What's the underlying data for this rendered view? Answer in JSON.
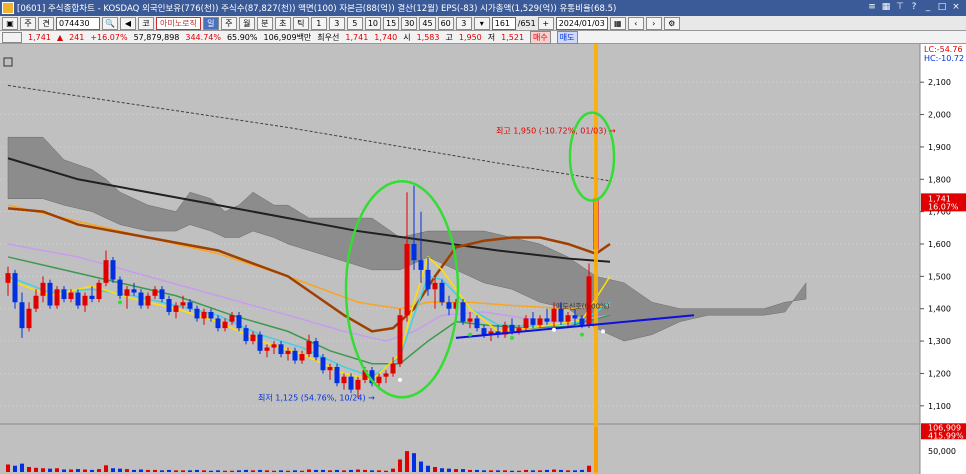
{
  "title": "[0601] 주식종합차트 - KOSDAQ 외국인보유(776(천)) 주식수(87,827(천)) 액면(100) 자본금(88(억)) 결산(12월) EPS(-83) 시가총액(1,529(억)) 유통비율(68.5)",
  "toolbar": {
    "code": "074430",
    "stock_name": "아미노로직",
    "periods": [
      "주",
      "월",
      "분",
      "초",
      "틱"
    ],
    "minute_options": [
      "1",
      "3",
      "5",
      "10",
      "15",
      "30",
      "45",
      "60"
    ],
    "count_value": "161",
    "count_total": "/651",
    "date": "2024/01/03",
    "left_labels": [
      "주",
      "견"
    ],
    "kind_label": "코"
  },
  "quote": {
    "price": "1,741",
    "change": "241",
    "change_pct": "+16.07%",
    "volume": "57,879,898",
    "vol_ratio": "344.74%",
    "turnover": "65.90%",
    "amount": "106,909백만",
    "best_label": "최우선",
    "ask": "1,741",
    "bid": "1,740",
    "open_label": "시",
    "open": "1,583",
    "high_label": "고",
    "high": "1,950",
    "low_label": "저",
    "low": "1,521",
    "buy_label": "매수",
    "sell_label": "매도"
  },
  "colors": {
    "up": "#e00000",
    "down": "#0030e0",
    "cloud": "#8c8c8c",
    "ma_black": "#202020",
    "ma_brown": "#a04000",
    "ma_orange": "#f5a623",
    "ma_violet": "#c79cf0",
    "ma_green": "#3a9a50",
    "ma_cyan": "#40d0e0",
    "ma_yellow": "#ffe000",
    "highlight": "#33dd33",
    "trend": "#1010dd",
    "cursor": "#ffb000"
  },
  "chart_data": {
    "type": "candlestick",
    "y_axis_ticks": [
      "2,100",
      "2,000",
      "1,900",
      "1,800",
      "1,700",
      "1,600",
      "1,500",
      "1,400",
      "1,300",
      "1,200",
      "1,100"
    ],
    "ylim": [
      1050,
      2150
    ],
    "current_price_label": "1,741",
    "current_change_label": "16.07%",
    "lc_label": "LC:-54.76",
    "hc_label": "HC:-10.72",
    "high_annotation": "최고 1,950 (-10.72%, 01/03)",
    "low_annotation": "최저 1,125 (54.76%, 10/24)",
    "mid_annotation": "매도신호(0.00%)",
    "volume_axis_ticks": [
      "50,000"
    ],
    "volume_current_label": "106,909",
    "volume_pct_label": "415.99%",
    "volume_ylim": [
      0,
      110000
    ],
    "candles": [
      {
        "o": 1480,
        "h": 1530,
        "l": 1440,
        "c": 1510,
        "v": 18000
      },
      {
        "o": 1510,
        "h": 1520,
        "l": 1400,
        "c": 1420,
        "v": 15000
      },
      {
        "o": 1420,
        "h": 1450,
        "l": 1310,
        "c": 1340,
        "v": 20000
      },
      {
        "o": 1340,
        "h": 1420,
        "l": 1330,
        "c": 1400,
        "v": 12000
      },
      {
        "o": 1400,
        "h": 1460,
        "l": 1390,
        "c": 1440,
        "v": 10000
      },
      {
        "o": 1440,
        "h": 1500,
        "l": 1420,
        "c": 1480,
        "v": 9000
      },
      {
        "o": 1480,
        "h": 1490,
        "l": 1400,
        "c": 1410,
        "v": 8000
      },
      {
        "o": 1410,
        "h": 1470,
        "l": 1400,
        "c": 1460,
        "v": 9000
      },
      {
        "o": 1460,
        "h": 1470,
        "l": 1420,
        "c": 1430,
        "v": 6000
      },
      {
        "o": 1430,
        "h": 1460,
        "l": 1420,
        "c": 1450,
        "v": 6000
      },
      {
        "o": 1450,
        "h": 1460,
        "l": 1400,
        "c": 1410,
        "v": 7000
      },
      {
        "o": 1410,
        "h": 1450,
        "l": 1390,
        "c": 1440,
        "v": 6000
      },
      {
        "o": 1440,
        "h": 1470,
        "l": 1420,
        "c": 1430,
        "v": 5000
      },
      {
        "o": 1430,
        "h": 1490,
        "l": 1420,
        "c": 1480,
        "v": 7000
      },
      {
        "o": 1480,
        "h": 1580,
        "l": 1470,
        "c": 1550,
        "v": 16000
      },
      {
        "o": 1550,
        "h": 1560,
        "l": 1480,
        "c": 1490,
        "v": 9000
      },
      {
        "o": 1490,
        "h": 1500,
        "l": 1430,
        "c": 1440,
        "v": 8000
      },
      {
        "o": 1440,
        "h": 1470,
        "l": 1400,
        "c": 1460,
        "v": 7000
      },
      {
        "o": 1460,
        "h": 1480,
        "l": 1440,
        "c": 1450,
        "v": 5000
      },
      {
        "o": 1450,
        "h": 1460,
        "l": 1400,
        "c": 1410,
        "v": 6000
      },
      {
        "o": 1410,
        "h": 1450,
        "l": 1400,
        "c": 1440,
        "v": 5000
      },
      {
        "o": 1440,
        "h": 1470,
        "l": 1430,
        "c": 1460,
        "v": 5000
      },
      {
        "o": 1460,
        "h": 1470,
        "l": 1420,
        "c": 1430,
        "v": 4000
      },
      {
        "o": 1430,
        "h": 1440,
        "l": 1380,
        "c": 1390,
        "v": 5000
      },
      {
        "o": 1390,
        "h": 1420,
        "l": 1370,
        "c": 1410,
        "v": 4000
      },
      {
        "o": 1410,
        "h": 1440,
        "l": 1400,
        "c": 1420,
        "v": 4000
      },
      {
        "o": 1420,
        "h": 1430,
        "l": 1390,
        "c": 1400,
        "v": 4000
      },
      {
        "o": 1400,
        "h": 1410,
        "l": 1360,
        "c": 1370,
        "v": 5000
      },
      {
        "o": 1370,
        "h": 1400,
        "l": 1350,
        "c": 1390,
        "v": 4000
      },
      {
        "o": 1390,
        "h": 1400,
        "l": 1360,
        "c": 1370,
        "v": 3000
      },
      {
        "o": 1370,
        "h": 1380,
        "l": 1330,
        "c": 1340,
        "v": 4000
      },
      {
        "o": 1340,
        "h": 1370,
        "l": 1330,
        "c": 1360,
        "v": 3000
      },
      {
        "o": 1360,
        "h": 1390,
        "l": 1350,
        "c": 1380,
        "v": 3000
      },
      {
        "o": 1380,
        "h": 1390,
        "l": 1330,
        "c": 1340,
        "v": 4000
      },
      {
        "o": 1340,
        "h": 1350,
        "l": 1290,
        "c": 1300,
        "v": 5000
      },
      {
        "o": 1300,
        "h": 1330,
        "l": 1290,
        "c": 1320,
        "v": 4000
      },
      {
        "o": 1320,
        "h": 1330,
        "l": 1260,
        "c": 1270,
        "v": 5000
      },
      {
        "o": 1270,
        "h": 1290,
        "l": 1250,
        "c": 1280,
        "v": 4000
      },
      {
        "o": 1280,
        "h": 1300,
        "l": 1260,
        "c": 1290,
        "v": 3000
      },
      {
        "o": 1290,
        "h": 1300,
        "l": 1250,
        "c": 1260,
        "v": 4000
      },
      {
        "o": 1260,
        "h": 1280,
        "l": 1240,
        "c": 1270,
        "v": 3000
      },
      {
        "o": 1270,
        "h": 1280,
        "l": 1230,
        "c": 1240,
        "v": 4000
      },
      {
        "o": 1240,
        "h": 1270,
        "l": 1230,
        "c": 1260,
        "v": 3000
      },
      {
        "o": 1260,
        "h": 1320,
        "l": 1250,
        "c": 1300,
        "v": 6000
      },
      {
        "o": 1300,
        "h": 1310,
        "l": 1240,
        "c": 1250,
        "v": 5000
      },
      {
        "o": 1250,
        "h": 1260,
        "l": 1200,
        "c": 1210,
        "v": 5000
      },
      {
        "o": 1210,
        "h": 1230,
        "l": 1180,
        "c": 1220,
        "v": 4000
      },
      {
        "o": 1220,
        "h": 1230,
        "l": 1160,
        "c": 1170,
        "v": 5000
      },
      {
        "o": 1170,
        "h": 1200,
        "l": 1150,
        "c": 1190,
        "v": 4000
      },
      {
        "o": 1190,
        "h": 1200,
        "l": 1140,
        "c": 1150,
        "v": 5000
      },
      {
        "o": 1150,
        "h": 1190,
        "l": 1125,
        "c": 1180,
        "v": 6000
      },
      {
        "o": 1180,
        "h": 1220,
        "l": 1170,
        "c": 1210,
        "v": 5000
      },
      {
        "o": 1210,
        "h": 1220,
        "l": 1160,
        "c": 1170,
        "v": 4000
      },
      {
        "o": 1170,
        "h": 1200,
        "l": 1150,
        "c": 1190,
        "v": 4000
      },
      {
        "o": 1190,
        "h": 1210,
        "l": 1170,
        "c": 1200,
        "v": 3000
      },
      {
        "o": 1200,
        "h": 1250,
        "l": 1190,
        "c": 1230,
        "v": 8000
      },
      {
        "o": 1230,
        "h": 1400,
        "l": 1220,
        "c": 1380,
        "v": 30000
      },
      {
        "o": 1380,
        "h": 1760,
        "l": 1360,
        "c": 1600,
        "v": 50000
      },
      {
        "o": 1600,
        "h": 1780,
        "l": 1520,
        "c": 1550,
        "v": 45000
      },
      {
        "o": 1550,
        "h": 1700,
        "l": 1480,
        "c": 1520,
        "v": 25000
      },
      {
        "o": 1520,
        "h": 1560,
        "l": 1440,
        "c": 1460,
        "v": 15000
      },
      {
        "o": 1460,
        "h": 1500,
        "l": 1400,
        "c": 1480,
        "v": 12000
      },
      {
        "o": 1480,
        "h": 1490,
        "l": 1410,
        "c": 1420,
        "v": 9000
      },
      {
        "o": 1420,
        "h": 1440,
        "l": 1380,
        "c": 1400,
        "v": 8000
      },
      {
        "o": 1400,
        "h": 1430,
        "l": 1380,
        "c": 1420,
        "v": 7000
      },
      {
        "o": 1420,
        "h": 1430,
        "l": 1350,
        "c": 1360,
        "v": 7000
      },
      {
        "o": 1360,
        "h": 1390,
        "l": 1340,
        "c": 1370,
        "v": 5000
      },
      {
        "o": 1370,
        "h": 1380,
        "l": 1330,
        "c": 1340,
        "v": 5000
      },
      {
        "o": 1340,
        "h": 1350,
        "l": 1310,
        "c": 1320,
        "v": 4000
      },
      {
        "o": 1320,
        "h": 1340,
        "l": 1300,
        "c": 1330,
        "v": 4000
      },
      {
        "o": 1330,
        "h": 1350,
        "l": 1310,
        "c": 1320,
        "v": 4000
      },
      {
        "o": 1320,
        "h": 1360,
        "l": 1310,
        "c": 1350,
        "v": 4000
      },
      {
        "o": 1350,
        "h": 1370,
        "l": 1320,
        "c": 1330,
        "v": 3000
      },
      {
        "o": 1330,
        "h": 1350,
        "l": 1320,
        "c": 1340,
        "v": 3000
      },
      {
        "o": 1340,
        "h": 1380,
        "l": 1330,
        "c": 1370,
        "v": 5000
      },
      {
        "o": 1370,
        "h": 1390,
        "l": 1340,
        "c": 1350,
        "v": 4000
      },
      {
        "o": 1350,
        "h": 1380,
        "l": 1340,
        "c": 1370,
        "v": 4000
      },
      {
        "o": 1370,
        "h": 1400,
        "l": 1350,
        "c": 1360,
        "v": 5000
      },
      {
        "o": 1360,
        "h": 1420,
        "l": 1340,
        "c": 1400,
        "v": 6000
      },
      {
        "o": 1400,
        "h": 1420,
        "l": 1350,
        "c": 1360,
        "v": 5000
      },
      {
        "o": 1360,
        "h": 1390,
        "l": 1340,
        "c": 1380,
        "v": 4000
      },
      {
        "o": 1380,
        "h": 1400,
        "l": 1350,
        "c": 1370,
        "v": 4000
      },
      {
        "o": 1370,
        "h": 1380,
        "l": 1340,
        "c": 1350,
        "v": 5000
      },
      {
        "o": 1350,
        "h": 1540,
        "l": 1340,
        "c": 1500,
        "v": 15000
      },
      {
        "o": 1583,
        "h": 1950,
        "l": 1521,
        "c": 1741,
        "v": 106909
      }
    ],
    "cloud_upper": [
      [
        0,
        1930
      ],
      [
        5,
        1930
      ],
      [
        8,
        1860
      ],
      [
        12,
        1830
      ],
      [
        14,
        1800
      ],
      [
        16,
        1760
      ],
      [
        20,
        1720
      ],
      [
        24,
        1700
      ],
      [
        26,
        1760
      ],
      [
        29,
        1740
      ],
      [
        31,
        1700
      ],
      [
        33,
        1720
      ],
      [
        35,
        1760
      ],
      [
        38,
        1720
      ],
      [
        40,
        1720
      ],
      [
        43,
        1680
      ],
      [
        46,
        1680
      ],
      [
        52,
        1680
      ],
      [
        56,
        1620
      ],
      [
        60,
        1640
      ],
      [
        64,
        1640
      ],
      [
        68,
        1640
      ],
      [
        72,
        1620
      ],
      [
        76,
        1600
      ],
      [
        80,
        1560
      ],
      [
        84,
        1500
      ],
      [
        88,
        1480
      ],
      [
        92,
        1420
      ],
      [
        96,
        1400
      ],
      [
        100,
        1400
      ],
      [
        104,
        1400
      ],
      [
        108,
        1400
      ],
      [
        111,
        1420
      ],
      [
        114,
        1430
      ]
    ],
    "cloud_lower": [
      [
        0,
        1740
      ],
      [
        5,
        1740
      ],
      [
        8,
        1720
      ],
      [
        12,
        1700
      ],
      [
        14,
        1680
      ],
      [
        16,
        1660
      ],
      [
        20,
        1640
      ],
      [
        24,
        1640
      ],
      [
        26,
        1660
      ],
      [
        29,
        1640
      ],
      [
        31,
        1620
      ],
      [
        33,
        1620
      ],
      [
        35,
        1640
      ],
      [
        38,
        1620
      ],
      [
        40,
        1600
      ],
      [
        43,
        1580
      ],
      [
        46,
        1560
      ],
      [
        52,
        1520
      ],
      [
        56,
        1520
      ],
      [
        60,
        1560
      ],
      [
        64,
        1520
      ],
      [
        68,
        1480
      ],
      [
        72,
        1460
      ],
      [
        76,
        1420
      ],
      [
        80,
        1400
      ],
      [
        84,
        1340
      ],
      [
        88,
        1300
      ],
      [
        92,
        1320
      ],
      [
        96,
        1360
      ],
      [
        100,
        1380
      ],
      [
        104,
        1380
      ],
      [
        108,
        1380
      ],
      [
        111,
        1390
      ],
      [
        114,
        1480
      ]
    ],
    "ma_black": [
      [
        0,
        1865
      ],
      [
        10,
        1800
      ],
      [
        20,
        1760
      ],
      [
        30,
        1720
      ],
      [
        40,
        1680
      ],
      [
        50,
        1640
      ],
      [
        60,
        1610
      ],
      [
        70,
        1580
      ],
      [
        80,
        1555
      ],
      [
        86,
        1545
      ]
    ],
    "ma_brown": [
      [
        0,
        1710
      ],
      [
        5,
        1700
      ],
      [
        10,
        1660
      ],
      [
        15,
        1640
      ],
      [
        20,
        1620
      ],
      [
        25,
        1600
      ],
      [
        30,
        1580
      ],
      [
        35,
        1540
      ],
      [
        40,
        1500
      ],
      [
        44,
        1440
      ],
      [
        48,
        1380
      ],
      [
        52,
        1330
      ],
      [
        55,
        1340
      ],
      [
        58,
        1400
      ],
      [
        61,
        1500
      ],
      [
        64,
        1590
      ],
      [
        68,
        1610
      ],
      [
        72,
        1620
      ],
      [
        76,
        1620
      ],
      [
        80,
        1600
      ],
      [
        84,
        1570
      ],
      [
        86,
        1600
      ]
    ],
    "ma_orange": [
      [
        0,
        1720
      ],
      [
        10,
        1670
      ],
      [
        20,
        1620
      ],
      [
        30,
        1570
      ],
      [
        40,
        1500
      ],
      [
        50,
        1420
      ],
      [
        56,
        1400
      ],
      [
        60,
        1420
      ],
      [
        66,
        1420
      ],
      [
        72,
        1410
      ],
      [
        80,
        1400
      ],
      [
        86,
        1410
      ]
    ],
    "ma_violet": [
      [
        0,
        1600
      ],
      [
        10,
        1560
      ],
      [
        20,
        1500
      ],
      [
        30,
        1440
      ],
      [
        40,
        1380
      ],
      [
        48,
        1330
      ],
      [
        54,
        1300
      ],
      [
        58,
        1330
      ],
      [
        62,
        1380
      ],
      [
        68,
        1390
      ],
      [
        74,
        1370
      ],
      [
        80,
        1360
      ],
      [
        86,
        1380
      ]
    ],
    "ma_green": [
      [
        0,
        1560
      ],
      [
        8,
        1520
      ],
      [
        16,
        1480
      ],
      [
        24,
        1440
      ],
      [
        32,
        1380
      ],
      [
        40,
        1330
      ],
      [
        46,
        1270
      ],
      [
        52,
        1230
      ],
      [
        56,
        1230
      ],
      [
        60,
        1300
      ],
      [
        64,
        1360
      ],
      [
        68,
        1350
      ],
      [
        74,
        1340
      ],
      [
        80,
        1345
      ],
      [
        86,
        1380
      ]
    ],
    "ma_cyan": [
      [
        0,
        1500
      ],
      [
        6,
        1450
      ],
      [
        12,
        1460
      ],
      [
        18,
        1440
      ],
      [
        24,
        1410
      ],
      [
        30,
        1380
      ],
      [
        36,
        1320
      ],
      [
        42,
        1280
      ],
      [
        48,
        1220
      ],
      [
        52,
        1190
      ],
      [
        56,
        1250
      ],
      [
        58,
        1380
      ],
      [
        60,
        1500
      ],
      [
        62,
        1490
      ],
      [
        66,
        1400
      ],
      [
        70,
        1350
      ],
      [
        76,
        1345
      ],
      [
        82,
        1360
      ],
      [
        86,
        1420
      ]
    ],
    "ma_yellow": [
      [
        0,
        1490
      ],
      [
        6,
        1440
      ],
      [
        12,
        1470
      ],
      [
        18,
        1430
      ],
      [
        24,
        1400
      ],
      [
        30,
        1360
      ],
      [
        36,
        1300
      ],
      [
        42,
        1260
      ],
      [
        48,
        1200
      ],
      [
        52,
        1180
      ],
      [
        56,
        1260
      ],
      [
        58,
        1420
      ],
      [
        60,
        1560
      ],
      [
        62,
        1520
      ],
      [
        66,
        1400
      ],
      [
        70,
        1330
      ],
      [
        76,
        1345
      ],
      [
        82,
        1365
      ],
      [
        86,
        1500
      ]
    ],
    "long_ma_dashed": [
      [
        0,
        2090
      ],
      [
        40,
        1960
      ],
      [
        70,
        1850
      ],
      [
        86,
        1795
      ]
    ],
    "trend_line": [
      [
        64,
        1310
      ],
      [
        98,
        1380
      ]
    ]
  }
}
